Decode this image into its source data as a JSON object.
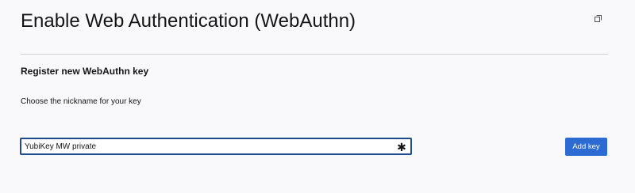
{
  "header": {
    "title": "Enable Web Authentication (WebAuthn)",
    "popout_icon": "popout-icon"
  },
  "section": {
    "title": "Register new WebAuthn key",
    "nickname_label": "Choose the nickname for your key"
  },
  "nickname_input": {
    "value": "YubiKey MW private",
    "required_icon": "asterisk-icon",
    "required_glyph": "✱"
  },
  "actions": {
    "add_key_label": "Add key"
  },
  "colors": {
    "primary": "#2c6bd1",
    "input_border_focus": "#1f4b8a",
    "background": "#f9f9fb"
  }
}
